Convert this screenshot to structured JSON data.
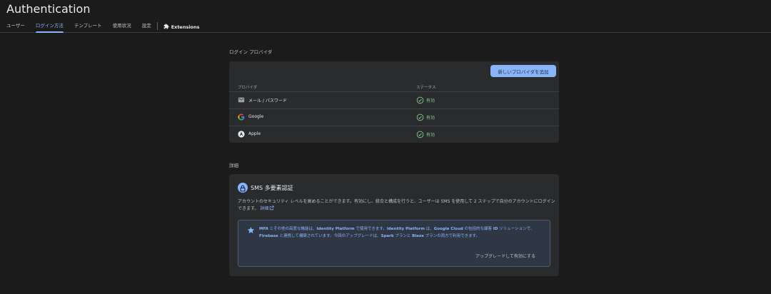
{
  "header": {
    "title": "Authentication",
    "tabs": [
      "ユーザー",
      "ログイン方法",
      "テンプレート",
      "使用状況",
      "設定"
    ],
    "extensions_label": "Extensions"
  },
  "providers_section": {
    "label": "ログイン プロバイダ",
    "add_button": "新しいプロバイダを追加",
    "col_provider": "プロバイダ",
    "col_status": "ステータス",
    "rows": [
      {
        "name": "メール / パスワード",
        "icon": "mail-icon",
        "status": "有効"
      },
      {
        "name": "Google",
        "icon": "google-icon",
        "status": "有効"
      },
      {
        "name": "Apple",
        "icon": "apple-icon",
        "status": "有効"
      }
    ]
  },
  "details_section": {
    "label": "詳細",
    "sms": {
      "title": "SMS 多要素認証",
      "description": "アカウントのセキュリティ レベルを高めることができます。有効にし、統合と構成を行うと、ユーザーは SMS を使用して 2 ステップで自分のアカウントにログインできます。",
      "link": "詳細",
      "info_parts": [
        "MFA",
        " とその他の高度な機能は、",
        "Identity Platform",
        " で使用できます。",
        "Identity Platform",
        " は、",
        "Google Cloud",
        " の包括的な顧客 ",
        "ID",
        " ソリューションで、",
        "Firebase",
        " と連携して構築されています。今回のアップグレードは、",
        "Spark",
        " プランと ",
        "Blaze",
        " プランの両方で利用できます。"
      ],
      "upgrade": "アップグレードして有効にする"
    }
  },
  "colors": {
    "accent": "#8ab4f8",
    "status_green": "#81c995",
    "background": "#1b1b1c",
    "card": "#2a2b2c"
  }
}
